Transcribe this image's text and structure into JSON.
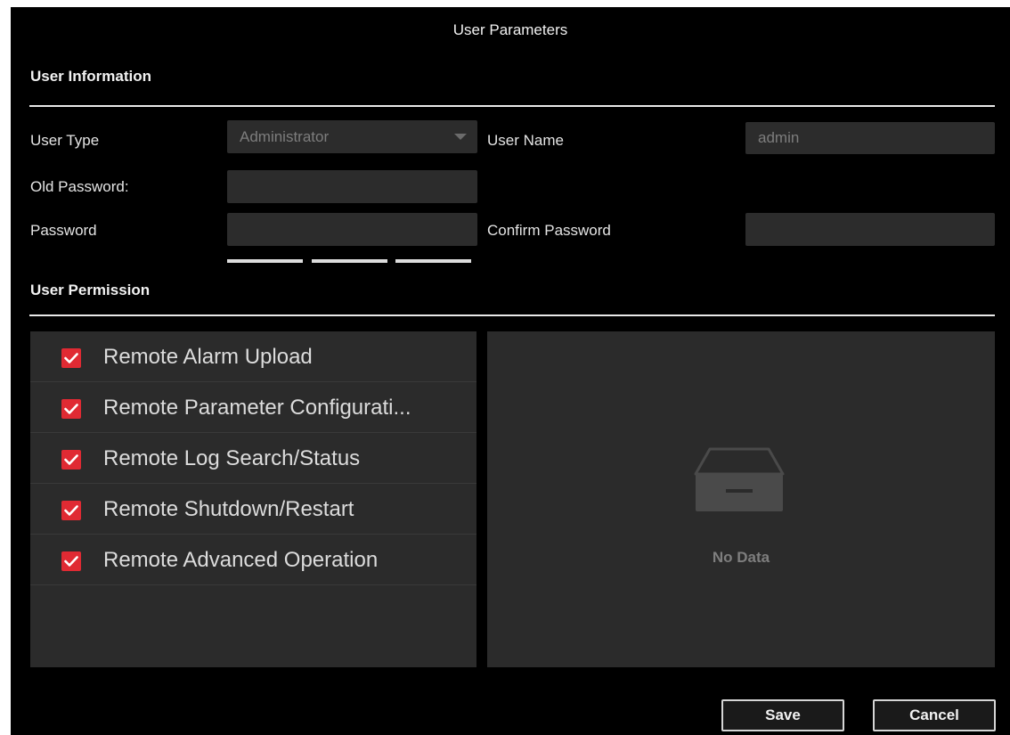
{
  "dialog": {
    "title": "User Parameters"
  },
  "user_info": {
    "heading": "User Information",
    "user_type_label": "User Type",
    "user_type_value": "Administrator",
    "user_name_label": "User Name",
    "user_name_value": "admin",
    "old_password_label": "Old Password:",
    "old_password_value": "",
    "password_label": "Password",
    "password_value": "",
    "confirm_password_label": "Confirm Password",
    "confirm_password_value": ""
  },
  "permissions": {
    "heading": "User Permission",
    "items": [
      {
        "label": "Remote Alarm Upload",
        "checked": true
      },
      {
        "label": "Remote Parameter Configurati...",
        "checked": true
      },
      {
        "label": "Remote Log Search/Status",
        "checked": true
      },
      {
        "label": "Remote Shutdown/Restart",
        "checked": true
      },
      {
        "label": "Remote Advanced Operation",
        "checked": true
      }
    ],
    "detail_empty_text": "No Data",
    "detail_empty_icon": "empty-box-icon"
  },
  "buttons": {
    "save": "Save",
    "cancel": "Cancel"
  },
  "colors": {
    "background": "#000000",
    "panel": "#2b2b2b",
    "checkbox_accent": "#e02a33"
  }
}
